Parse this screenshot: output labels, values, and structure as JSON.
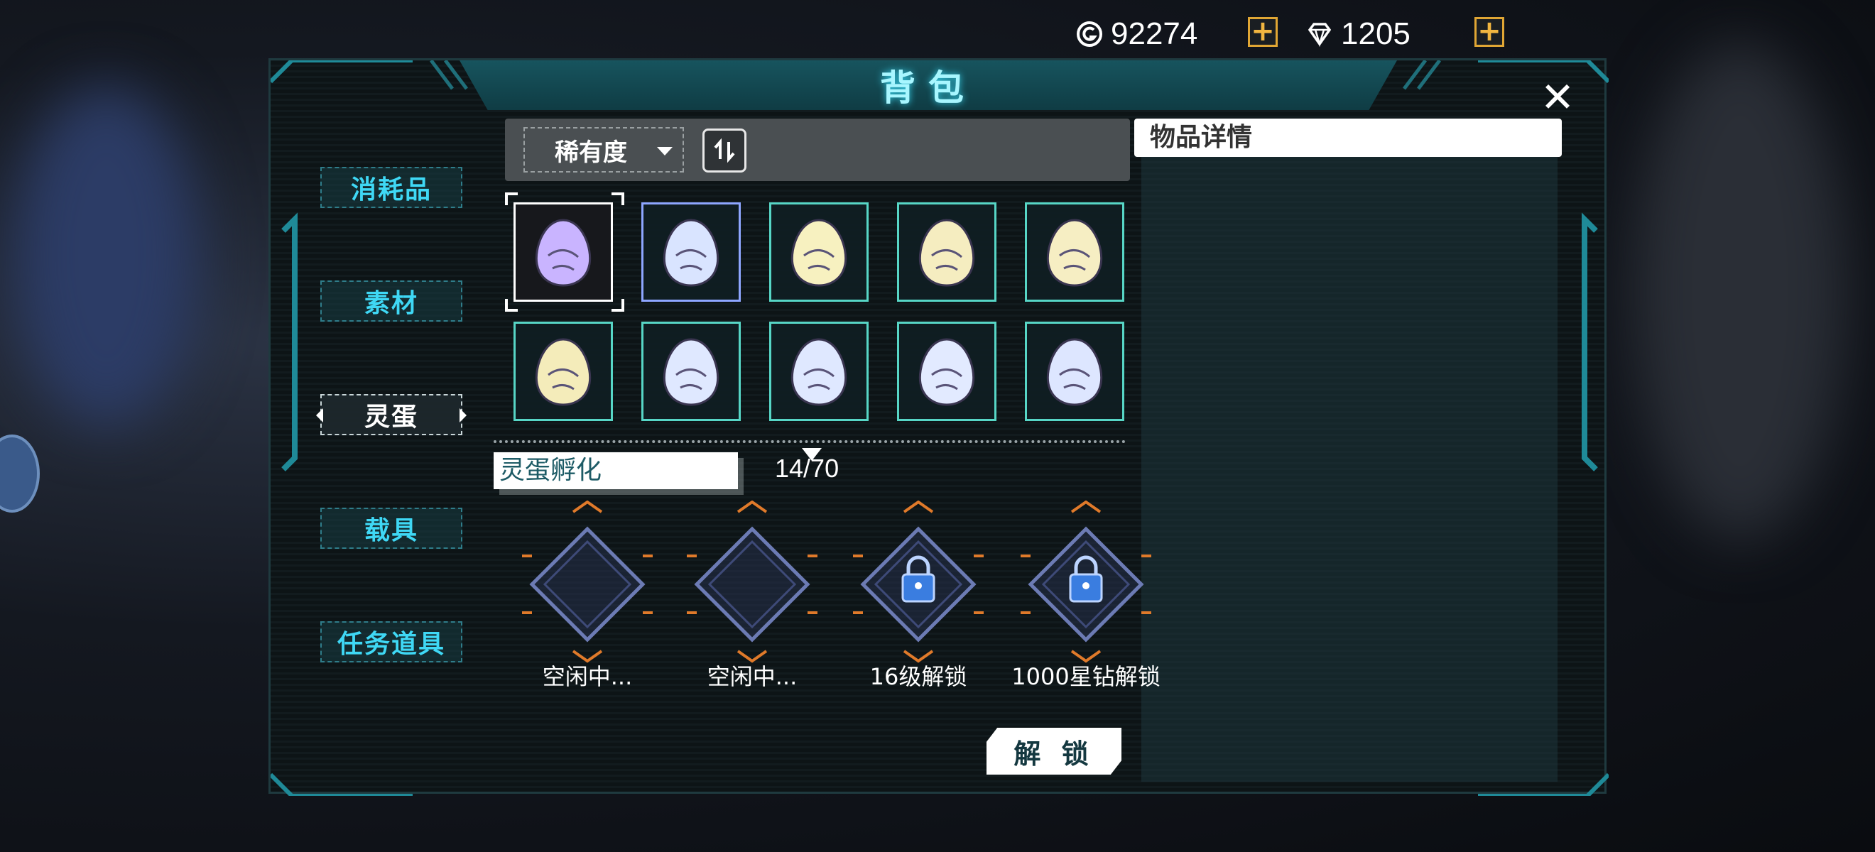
{
  "currency": {
    "coins": {
      "icon": "coin-g-icon",
      "value": "92274"
    },
    "diamonds": {
      "icon": "diamond-icon",
      "value": "1205"
    }
  },
  "panel": {
    "title": "背包",
    "categories": [
      {
        "label": "消耗品",
        "active": false
      },
      {
        "label": "素材",
        "active": false
      },
      {
        "label": "灵蛋",
        "active": true
      },
      {
        "label": "载具",
        "active": false
      },
      {
        "label": "任务道具",
        "active": false
      }
    ],
    "sort": {
      "selected": "稀有度"
    },
    "details": {
      "title": "物品详情"
    },
    "items": [
      {
        "icon": "purple-spiky-egg-icon",
        "color": "#c9b4ff",
        "border": "white"
      },
      {
        "icon": "blue-striped-egg-icon",
        "color": "#d9e4ff",
        "border": "blue"
      },
      {
        "icon": "yellow-chick-egg-icon",
        "color": "#f7f1c0",
        "border": "teal"
      },
      {
        "icon": "yellow-cat-egg-icon",
        "color": "#f5edc0",
        "border": "teal"
      },
      {
        "icon": "yellow-crown-egg-icon",
        "color": "#f6eec3",
        "border": "teal"
      },
      {
        "icon": "yellow-horned-egg-icon",
        "color": "#f4ecba",
        "border": "teal"
      },
      {
        "icon": "blue-spider-egg-icon",
        "color": "#dfe8ff",
        "border": "teal"
      },
      {
        "icon": "blue-spider-egg-icon",
        "color": "#dfe8ff",
        "border": "teal"
      },
      {
        "icon": "blue-swirl-egg-icon",
        "color": "#e2eaff",
        "border": "teal"
      },
      {
        "icon": "blue-fluffy-egg-icon",
        "color": "#dde6ff",
        "border": "teal"
      }
    ],
    "hatch": {
      "title": "灵蛋孵化",
      "count": "14/70",
      "incubators": [
        {
          "label": "空闲中...",
          "locked": false
        },
        {
          "label": "空闲中...",
          "locked": false
        },
        {
          "label": "16级解锁",
          "locked": true
        },
        {
          "label": "1000星钻解锁",
          "locked": true
        }
      ],
      "unlock_label": "解 锁"
    }
  },
  "colors": {
    "accent": "#3fd8f5",
    "frame": "#1f8a98",
    "orange": "#e07a2a"
  }
}
